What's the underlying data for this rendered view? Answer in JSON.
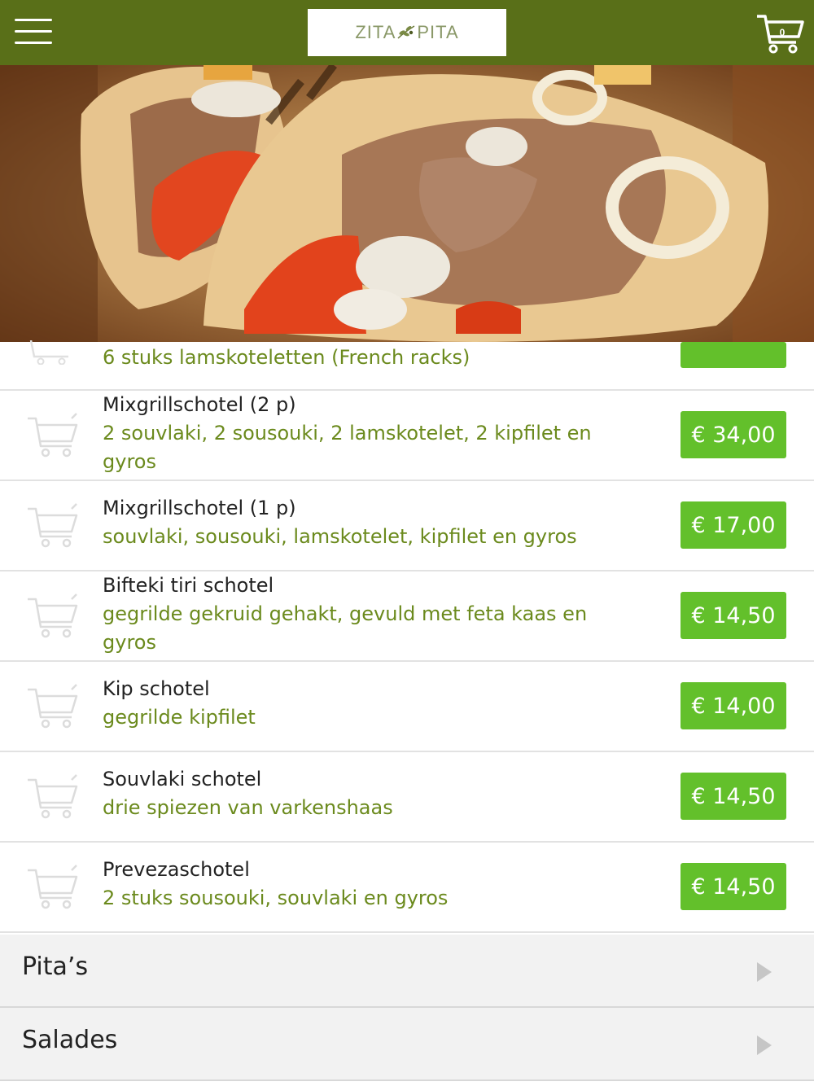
{
  "header": {
    "menu_icon": "hamburger-menu-icon",
    "logo": {
      "part1": "ZITA",
      "part2": "PITA"
    },
    "cart": {
      "icon": "shopping-cart-icon",
      "count": "0"
    },
    "background_color": "#596f18"
  },
  "hero": {
    "description": "gyros pita photo"
  },
  "menu_items": [
    {
      "name": "",
      "description": "6 stuks lamskoteletten (French racks)",
      "price": ""
    },
    {
      "name": "Mixgrillschotel (2 p)",
      "description": "2 souvlaki, 2 sousouki, 2 lamskotelet, 2 kipfilet en gyros",
      "price": "€ 34,00"
    },
    {
      "name": "Mixgrillschotel (1 p)",
      "description": "souvlaki, sousouki, lamskotelet, kipfilet en gyros",
      "price": "€ 17,00"
    },
    {
      "name": "Bifteki tiri schotel",
      "description": "gegrilde gekruid gehakt, gevuld met feta kaas en gyros",
      "price": "€ 14,50"
    },
    {
      "name": "Kip schotel",
      "description": "gegrilde kipfilet",
      "price": "€ 14,00"
    },
    {
      "name": "Souvlaki schotel",
      "description": "drie spiezen van varkenshaas",
      "price": "€ 14,50"
    },
    {
      "name": "Prevezaschotel",
      "description": "2 stuks sousouki, souvlaki en gyros",
      "price": "€ 14,50"
    }
  ],
  "categories": [
    {
      "label": "Pita’s",
      "icon": "arrow-right-icon"
    },
    {
      "label": "Salades",
      "icon": "arrow-right-icon"
    }
  ],
  "colors": {
    "price_button": "#63c02b",
    "description_text": "#6b8a1d"
  }
}
